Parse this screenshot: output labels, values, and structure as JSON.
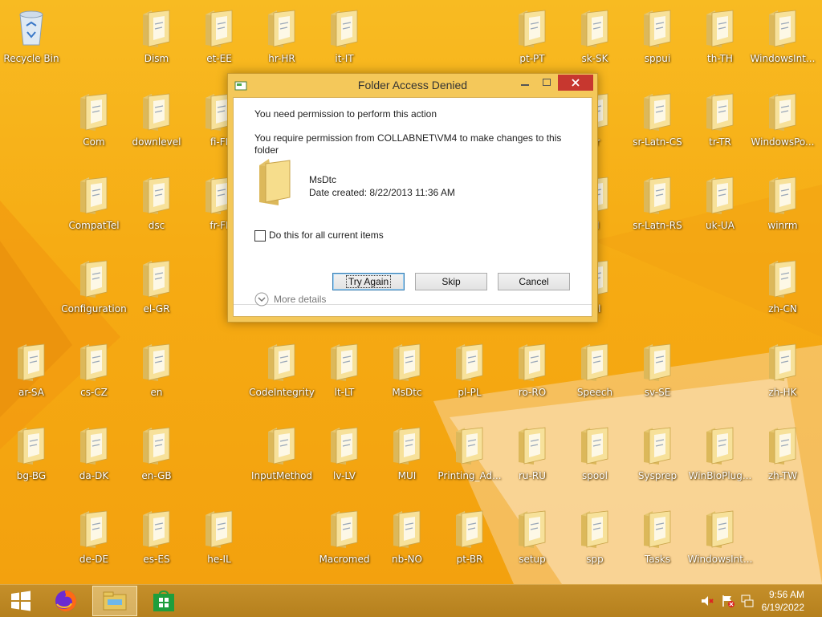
{
  "desktop": {
    "icons": [
      {
        "id": "recycle-bin",
        "label": "Recycle Bin",
        "type": "bin"
      },
      {
        "id": "dism",
        "label": "Dism",
        "type": "folder"
      },
      {
        "id": "et-ee",
        "label": "et-EE",
        "type": "folder"
      },
      {
        "id": "hr-hr",
        "label": "hr-HR",
        "type": "folder"
      },
      {
        "id": "it-it",
        "label": "it-IT",
        "type": "folder"
      },
      {
        "id": "pt-pt",
        "label": "pt-PT",
        "type": "folder"
      },
      {
        "id": "sk-sk",
        "label": "sk-SK",
        "type": "folder"
      },
      {
        "id": "sppui",
        "label": "sppui",
        "type": "folder"
      },
      {
        "id": "th-th",
        "label": "th-TH",
        "type": "folder"
      },
      {
        "id": "windowsint-1",
        "label": "WindowsInt...",
        "type": "folder"
      },
      {
        "id": "com",
        "label": "Com",
        "type": "folder"
      },
      {
        "id": "downlevel",
        "label": "downlevel",
        "type": "folder"
      },
      {
        "id": "fi-fi",
        "label": "fi-FI",
        "type": "folder"
      },
      {
        "id": "gr",
        "label": "gr",
        "type": "folder"
      },
      {
        "id": "sr-latn-cs",
        "label": "sr-Latn-CS",
        "type": "folder"
      },
      {
        "id": "tr-tr",
        "label": "tr-TR",
        "type": "folder"
      },
      {
        "id": "windowspo",
        "label": "WindowsPo...",
        "type": "folder"
      },
      {
        "id": "compattel",
        "label": "CompatTel",
        "type": "folder"
      },
      {
        "id": "dsc",
        "label": "dsc",
        "type": "folder"
      },
      {
        "id": "fr-fr",
        "label": "fr-FI",
        "type": "folder"
      },
      {
        "id": "sl",
        "label": "SI",
        "type": "folder"
      },
      {
        "id": "sr-latn-rs",
        "label": "sr-Latn-RS",
        "type": "folder"
      },
      {
        "id": "uk-ua",
        "label": "uk-UA",
        "type": "folder"
      },
      {
        "id": "winrm",
        "label": "winrm",
        "type": "folder"
      },
      {
        "id": "configuration",
        "label": "Configuration",
        "type": "folder"
      },
      {
        "id": "el-gr",
        "label": "el-GR",
        "type": "folder"
      },
      {
        "id": "ml",
        "label": "ml",
        "type": "folder"
      },
      {
        "id": "zh-cn",
        "label": "zh-CN",
        "type": "folder"
      },
      {
        "id": "ar-sa",
        "label": "ar-SA",
        "type": "folder"
      },
      {
        "id": "cs-cz",
        "label": "cs-CZ",
        "type": "folder"
      },
      {
        "id": "en",
        "label": "en",
        "type": "folder"
      },
      {
        "id": "codeintegrity",
        "label": "CodeIntegrity",
        "type": "folder"
      },
      {
        "id": "lt-lt",
        "label": "lt-LT",
        "type": "folder"
      },
      {
        "id": "msdtc",
        "label": "MsDtc",
        "type": "folder"
      },
      {
        "id": "pl-pl",
        "label": "pl-PL",
        "type": "folder"
      },
      {
        "id": "ro-ro",
        "label": "ro-RO",
        "type": "folder"
      },
      {
        "id": "speech",
        "label": "Speech",
        "type": "folder"
      },
      {
        "id": "sv-se",
        "label": "sv-SE",
        "type": "folder"
      },
      {
        "id": "zh-hk",
        "label": "zh-HK",
        "type": "folder"
      },
      {
        "id": "bg-bg",
        "label": "bg-BG",
        "type": "folder"
      },
      {
        "id": "da-dk",
        "label": "da-DK",
        "type": "folder"
      },
      {
        "id": "en-gb",
        "label": "en-GB",
        "type": "folder"
      },
      {
        "id": "inputmethod",
        "label": "InputMethod",
        "type": "folder"
      },
      {
        "id": "lv-lv",
        "label": "lv-LV",
        "type": "folder"
      },
      {
        "id": "mui",
        "label": "MUI",
        "type": "folder"
      },
      {
        "id": "printing-ad",
        "label": "Printing_Ad...",
        "type": "folder"
      },
      {
        "id": "ru-ru",
        "label": "ru-RU",
        "type": "folder"
      },
      {
        "id": "spool",
        "label": "spool",
        "type": "folder"
      },
      {
        "id": "sysprep",
        "label": "Sysprep",
        "type": "folder"
      },
      {
        "id": "winbioplug",
        "label": "WinBioPlug...",
        "type": "folder"
      },
      {
        "id": "zh-tw",
        "label": "zh-TW",
        "type": "folder"
      },
      {
        "id": "de-de",
        "label": "de-DE",
        "type": "folder"
      },
      {
        "id": "es-es",
        "label": "es-ES",
        "type": "folder"
      },
      {
        "id": "he-il",
        "label": "he-IL",
        "type": "folder"
      },
      {
        "id": "macromed",
        "label": "Macromed",
        "type": "folder"
      },
      {
        "id": "nb-no",
        "label": "nb-NO",
        "type": "folder"
      },
      {
        "id": "pt-br",
        "label": "pt-BR",
        "type": "folder"
      },
      {
        "id": "setup",
        "label": "setup",
        "type": "folder"
      },
      {
        "id": "spp",
        "label": "spp",
        "type": "folder"
      },
      {
        "id": "tasks",
        "label": "Tasks",
        "type": "folder"
      },
      {
        "id": "windowsint-2",
        "label": "WindowsInt...",
        "type": "folder"
      }
    ]
  },
  "dialog": {
    "title": "Folder Access Denied",
    "heading": "You need permission to perform this action",
    "message": "You require permission from COLLABNET\\VM4 to make changes to this folder",
    "item_name": "MsDtc",
    "item_date": "Date created: 8/22/2013 11:36 AM",
    "checkbox_label": "Do this for all current items",
    "checkbox_checked": false,
    "buttons": {
      "try_again": "Try Again",
      "skip": "Skip",
      "cancel": "Cancel"
    },
    "more_details": "More details",
    "colors": {
      "close": "#c7372f",
      "frame": "#f4c85a"
    }
  },
  "taskbar": {
    "items": [
      "start-icon",
      "firefox-icon",
      "file-explorer-icon",
      "store-icon"
    ],
    "tray": [
      "volume-muted-icon",
      "action-center-icon",
      "network-icon"
    ],
    "time": "9:56 AM",
    "date": "6/19/2022"
  }
}
